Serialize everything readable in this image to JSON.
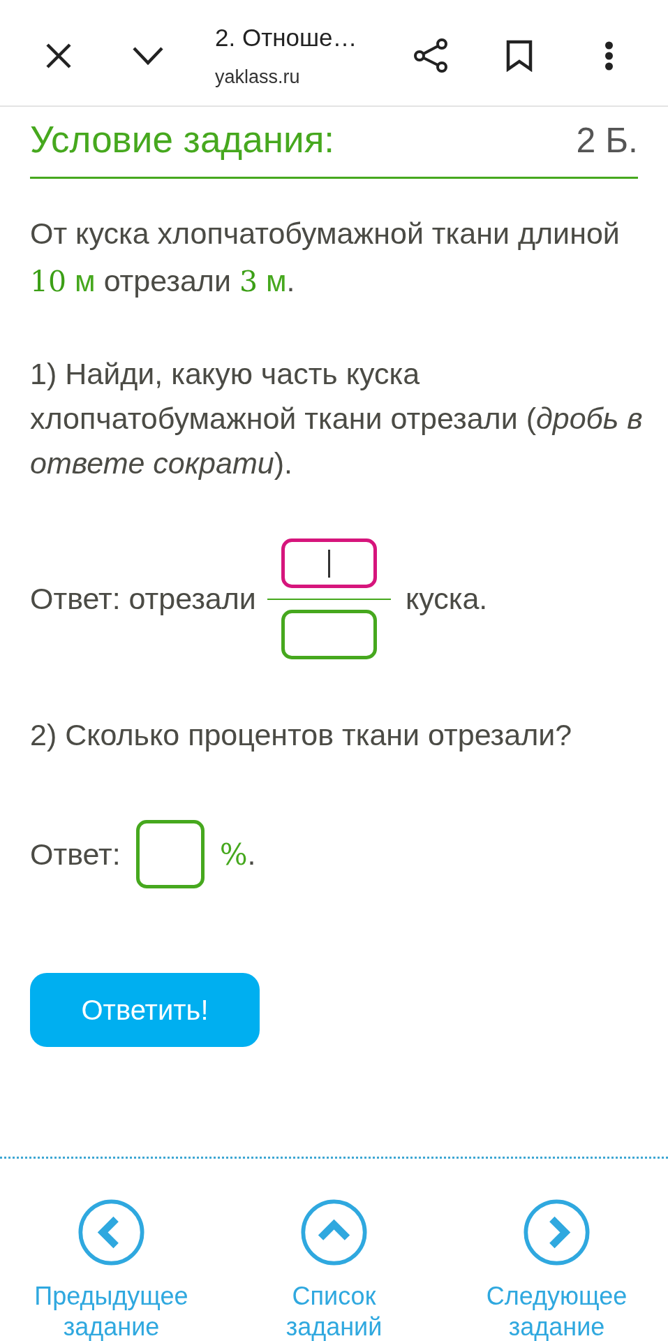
{
  "top_bar": {
    "title": "2. Отноше…",
    "url": "yaklass.ru"
  },
  "task": {
    "heading": "Условие задания:",
    "points": "2 Б.",
    "statement": [
      {
        "kind": "text",
        "text": "От куска хлопчатобумажной ткани длиной "
      },
      {
        "kind": "number",
        "text": "10"
      },
      {
        "kind": "unit",
        "text": " м"
      },
      {
        "kind": "text",
        "text": " отрезали "
      },
      {
        "kind": "number",
        "text": "3"
      },
      {
        "kind": "unit",
        "text": " м"
      },
      {
        "kind": "text",
        "text": "."
      }
    ],
    "questions": [
      {
        "text": "1) Найди, какую часть куска хлопчатобумажной ткани отрезали (*дробь в ответе сократи*).",
        "answer": {
          "kind": "fraction",
          "label": "Ответ: отрезали",
          "numerator": {
            "focused": true
          },
          "denominator": {
            "focused": false
          },
          "suffix": "куска."
        }
      },
      {
        "text": "2) Сколько процентов ткани отрезали?",
        "answer": {
          "kind": "percent",
          "label": "Ответ:",
          "field": {
            "focused": false
          },
          "unit": "%",
          "suffix": "."
        }
      }
    ],
    "submit_button": "Ответить!"
  },
  "nav": [
    {
      "kind": "previous",
      "label": "Предыдущее задание"
    },
    {
      "kind": "list",
      "label": "Список заданий"
    },
    {
      "kind": "next",
      "label": "Следующее задание"
    }
  ]
}
